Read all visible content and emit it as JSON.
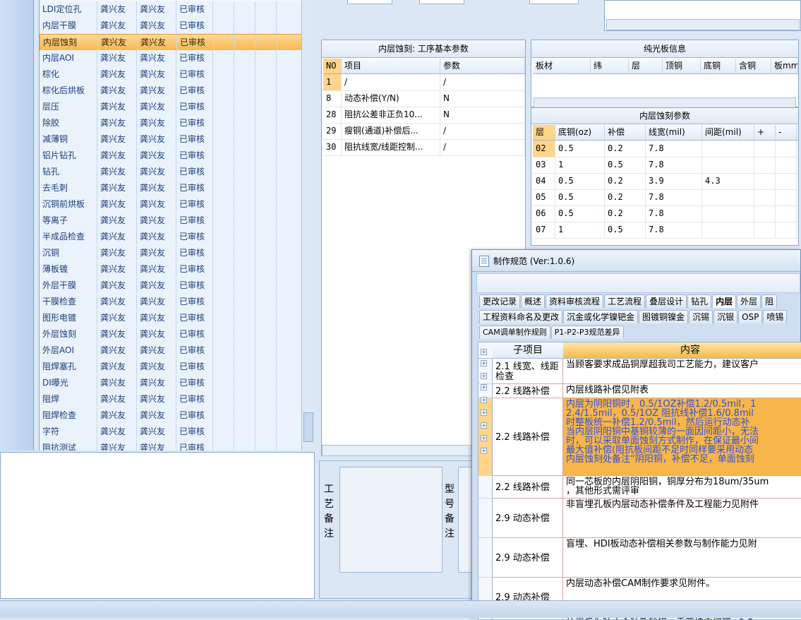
{
  "process_list": {
    "rows": [
      [
        "LDI定位孔",
        "龚兴友",
        "龚兴友",
        "已审核"
      ],
      [
        "内层干膜",
        "龚兴友",
        "龚兴友",
        "已审核"
      ],
      [
        "内层蚀刻",
        "龚兴友",
        "龚兴友",
        "已审核"
      ],
      [
        "内层AOI",
        "龚兴友",
        "龚兴友",
        "已审核"
      ],
      [
        "棕化",
        "龚兴友",
        "龚兴友",
        "已审核"
      ],
      [
        "棕化后烘板",
        "龚兴友",
        "龚兴友",
        "已审核"
      ],
      [
        "层压",
        "龚兴友",
        "龚兴友",
        "已审核"
      ],
      [
        "除胶",
        "龚兴友",
        "龚兴友",
        "已审核"
      ],
      [
        "减薄铜",
        "龚兴友",
        "龚兴友",
        "已审核"
      ],
      [
        "铝片钻孔",
        "龚兴友",
        "龚兴友",
        "已审核"
      ],
      [
        "钻孔",
        "龚兴友",
        "龚兴友",
        "已审核"
      ],
      [
        "去毛刺",
        "龚兴友",
        "龚兴友",
        "已审核"
      ],
      [
        "沉铜前烘板",
        "龚兴友",
        "龚兴友",
        "已审核"
      ],
      [
        "等离子",
        "龚兴友",
        "龚兴友",
        "已审核"
      ],
      [
        "半成品检查",
        "龚兴友",
        "龚兴友",
        "已审核"
      ],
      [
        "沉铜",
        "龚兴友",
        "龚兴友",
        "已审核"
      ],
      [
        "薄板镀",
        "龚兴友",
        "龚兴友",
        "已审核"
      ],
      [
        "外层干膜",
        "龚兴友",
        "龚兴友",
        "已审核"
      ],
      [
        "干膜检查",
        "龚兴友",
        "龚兴友",
        "已审核"
      ],
      [
        "图形电镀",
        "龚兴友",
        "龚兴友",
        "已审核"
      ],
      [
        "外层蚀刻",
        "龚兴友",
        "龚兴友",
        "已审核"
      ],
      [
        "外层AOI",
        "龚兴友",
        "龚兴友",
        "已审核"
      ],
      [
        "阻焊塞孔",
        "龚兴友",
        "龚兴友",
        "已审核"
      ],
      [
        "DI曝光",
        "龚兴友",
        "龚兴友",
        "已审核"
      ],
      [
        "阻焊",
        "龚兴友",
        "龚兴友",
        "已审核"
      ],
      [
        "阻焊检查",
        "龚兴友",
        "龚兴友",
        "已审核"
      ],
      [
        "字符",
        "龚兴友",
        "龚兴友",
        "已审核"
      ],
      [
        "阻抗测试",
        "龚兴友",
        "龚兴友",
        "已审核"
      ]
    ],
    "selected_index": 2
  },
  "etch_params": {
    "title": "内层蚀刻: 工序基本参数",
    "headers": [
      "NO",
      "项目",
      "参数"
    ],
    "rows": [
      [
        "1",
        "/",
        "/"
      ],
      [
        "8",
        "动态补偿(Y/N)",
        "N"
      ],
      [
        "28",
        "阻抗公差非正负10...",
        "N"
      ],
      [
        "29",
        "瘦铜(通道)补偿后...",
        "/"
      ],
      [
        "30",
        "阻抗线宽/线距控制...",
        "/"
      ]
    ]
  },
  "notes": {
    "process_label": "工艺备注",
    "model_label": "型号备注"
  },
  "bright_board": {
    "title": "纯光板信息",
    "headers": [
      "板材",
      "纬",
      "层",
      "顶铜",
      "底铜",
      "含铜",
      "板mm"
    ]
  },
  "inner_etch": {
    "title": "内层蚀刻参数",
    "headers": [
      "层",
      "底铜(oz)",
      "补偿",
      "线宽(mil)",
      "间距(mil)",
      "+",
      "-"
    ],
    "rows": [
      [
        "02",
        "0.5",
        "0.2",
        "7.8",
        ""
      ],
      [
        "03",
        "1",
        "0.5",
        "7.8",
        ""
      ],
      [
        "04",
        "0.5",
        "0.2",
        "3.9",
        "4.3"
      ],
      [
        "05",
        "0.5",
        "0.2",
        "7.8",
        ""
      ],
      [
        "06",
        "0.5",
        "0.2",
        "7.8",
        ""
      ],
      [
        "07",
        "1",
        "0.5",
        "7.8",
        ""
      ]
    ]
  },
  "dialog": {
    "title": "制作规范 (Ver:1.0.6)",
    "tabs_row1": [
      "更改记录",
      "概述",
      "资料审核流程",
      "工艺流程",
      "叠层设计",
      "钻孔",
      "内层",
      "外层",
      "阻"
    ],
    "active_tab": "内层",
    "tabs_row2": [
      "工程资料命名及更改",
      "沉金或化学镍钯金",
      "图镀铜镍金",
      "沉锡",
      "沉银",
      "OSP",
      "喷锡"
    ],
    "tabs_row3": [
      "CAM调单制作规则",
      "P1-P2-P3规范差异"
    ],
    "col_sub": "子项目",
    "col_content": "内容",
    "rows": [
      {
        "sub": "2.1 线宽、线距检查",
        "content": "当顾客要求成品铜厚超我司工艺能力，建议客户"
      },
      {
        "sub": "2.2 线路补偿",
        "content": "内层线路补偿见附表"
      },
      {
        "sub": "2.2 线路补偿",
        "content": "内层为阴阳铜时，0.5/1OZ补偿1.2/0.5mil，1\n2.4/1.5mil，0.5/1OZ 阻抗线补偿1.6/0.8mil\n时整板统一补偿1.2/0.5mil，然后运行动态补\n当内层阴阳铜中基铜较薄的一面因间距小，无法\n时，可以采取单面蚀刻方式制作，在保证最小间\n最大值补偿(阻抗板间距不足时同样要采用动态\n内层蚀刻处备注“阴阳铜，补偿不足，单面蚀刻"
      },
      {
        "sub": "2.2 线路补偿",
        "content": "同一芯板的内层阴阳铜，铜厚分布为18um/35um\n，其他形式需评审"
      },
      {
        "sub": "2.9 动态补偿",
        "content": "非盲埋孔板内层动态补偿条件及工程能力见附件"
      },
      {
        "sub": "2.9 动态补偿",
        "content": "盲埋、HDI板动态补偿相关参数与制作能力见附"
      },
      {
        "sub": "2.9 动态补偿",
        "content": "内层动态补偿CAM制作要求见附件。"
      },
      {
        "sub": "2.3 间距的检",
        "content": "补偿后为防止余胶及残铜，需要填实间距<3.5"
      }
    ]
  },
  "colors": {
    "selection": "#f9b54e",
    "content_highlight": "#f7b54a",
    "highlight_text": "#3050d8",
    "panel_bg": "#dbe7f5"
  }
}
